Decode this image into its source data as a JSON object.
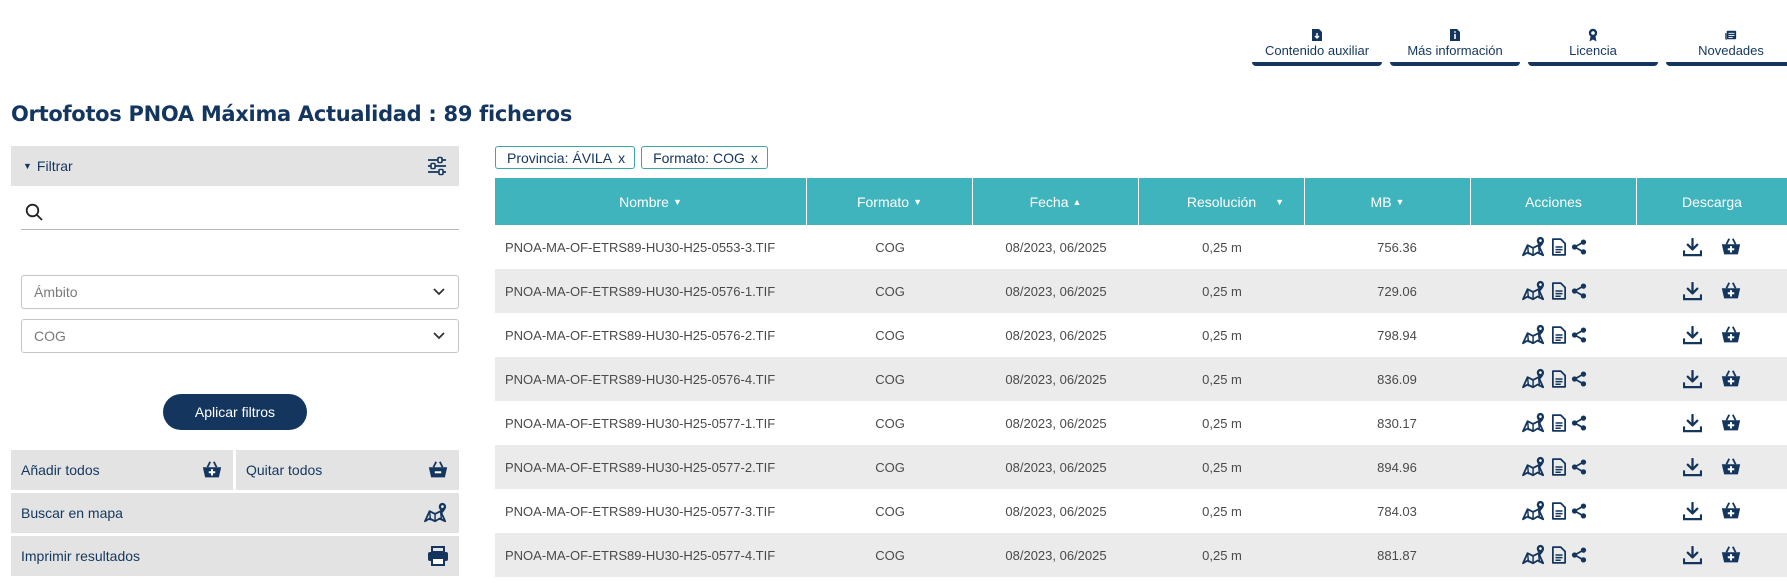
{
  "top_nav": [
    {
      "label": "Contenido auxiliar",
      "icon": "file-download-icon"
    },
    {
      "label": "Más información",
      "icon": "file-info-icon"
    },
    {
      "label": "Licencia",
      "icon": "award-icon"
    },
    {
      "label": "Novedades",
      "icon": "newspaper-icon"
    }
  ],
  "title": "Ortofotos PNOA Máxima Actualidad : 89  ficheros",
  "filter": {
    "label": "Filtrar",
    "search_value": ""
  },
  "selects": [
    {
      "value": "Ámbito"
    },
    {
      "value": "COG"
    }
  ],
  "apply_label": "Aplicar filtros",
  "actions": {
    "add_all": "Añadir todos",
    "remove_all": "Quitar todos",
    "search_map": "Buscar en mapa",
    "print": "Imprimir resultados"
  },
  "chips": [
    {
      "label": "Provincia: ÁVILA",
      "close": "x"
    },
    {
      "label": "Formato: COG",
      "close": "x"
    }
  ],
  "table": {
    "columns": [
      "Nombre",
      "Formato",
      "Fecha",
      "Resolución",
      "MB",
      "Acciones",
      "Descarga"
    ],
    "sort_arrows": {
      "Nombre": "▼",
      "Formato": "▼",
      "Fecha": "▲",
      "Resolución": "▼",
      "MB": "▼"
    },
    "rows": [
      {
        "name": "PNOA-MA-OF-ETRS89-HU30-H25-0553-3.TIF",
        "format": "COG",
        "date": "08/2023, 06/2025",
        "res": "0,25 m",
        "mb": "756.36"
      },
      {
        "name": "PNOA-MA-OF-ETRS89-HU30-H25-0576-1.TIF",
        "format": "COG",
        "date": "08/2023, 06/2025",
        "res": "0,25 m",
        "mb": "729.06"
      },
      {
        "name": "PNOA-MA-OF-ETRS89-HU30-H25-0576-2.TIF",
        "format": "COG",
        "date": "08/2023, 06/2025",
        "res": "0,25 m",
        "mb": "798.94"
      },
      {
        "name": "PNOA-MA-OF-ETRS89-HU30-H25-0576-4.TIF",
        "format": "COG",
        "date": "08/2023, 06/2025",
        "res": "0,25 m",
        "mb": "836.09"
      },
      {
        "name": "PNOA-MA-OF-ETRS89-HU30-H25-0577-1.TIF",
        "format": "COG",
        "date": "08/2023, 06/2025",
        "res": "0,25 m",
        "mb": "830.17"
      },
      {
        "name": "PNOA-MA-OF-ETRS89-HU30-H25-0577-2.TIF",
        "format": "COG",
        "date": "08/2023, 06/2025",
        "res": "0,25 m",
        "mb": "894.96"
      },
      {
        "name": "PNOA-MA-OF-ETRS89-HU30-H25-0577-3.TIF",
        "format": "COG",
        "date": "08/2023, 06/2025",
        "res": "0,25 m",
        "mb": "784.03"
      },
      {
        "name": "PNOA-MA-OF-ETRS89-HU30-H25-0577-4.TIF",
        "format": "COG",
        "date": "08/2023, 06/2025",
        "res": "0,25 m",
        "mb": "881.87"
      }
    ]
  },
  "colors": {
    "navy": "#14365e",
    "teal": "#40b4bd",
    "panel_gray": "#e3e3e3",
    "row_alt": "#ebebeb"
  }
}
